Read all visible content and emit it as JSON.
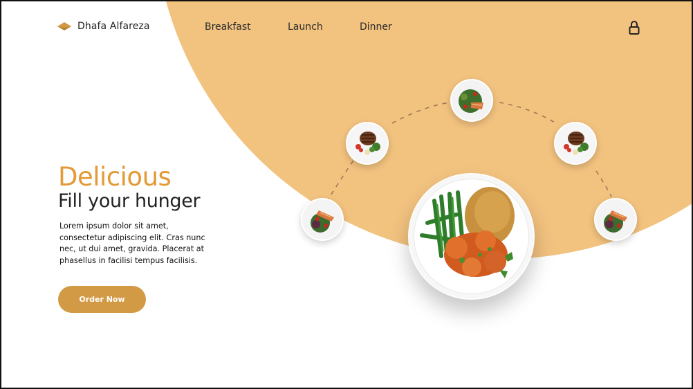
{
  "brand": {
    "name": "Dhafa Alfareza",
    "icon": "diamond-logo-icon",
    "color": "#d39a45"
  },
  "nav": {
    "links": [
      "Breakfast",
      "Launch",
      "Dinner"
    ],
    "cart_icon": "lock-icon"
  },
  "hero": {
    "title": "Delicious",
    "subtitle": "Fill your hunger",
    "description": "Lorem ipsum dolor sit amet, consectetur adipiscing elit. Cras nunc nec, ut dui amet, gravida. Placerat at phasellus in facilisi tempus facilisis.",
    "cta_label": "Order Now"
  },
  "colors": {
    "accent": "#f2c27f",
    "title_orange": "#e39a35",
    "button": "#d39a45",
    "text_dark": "#222222"
  },
  "dishes": [
    "salmon-salad",
    "steak-plate",
    "salmon-salad-top",
    "steak-plate-right",
    "salmon-salad-right"
  ]
}
